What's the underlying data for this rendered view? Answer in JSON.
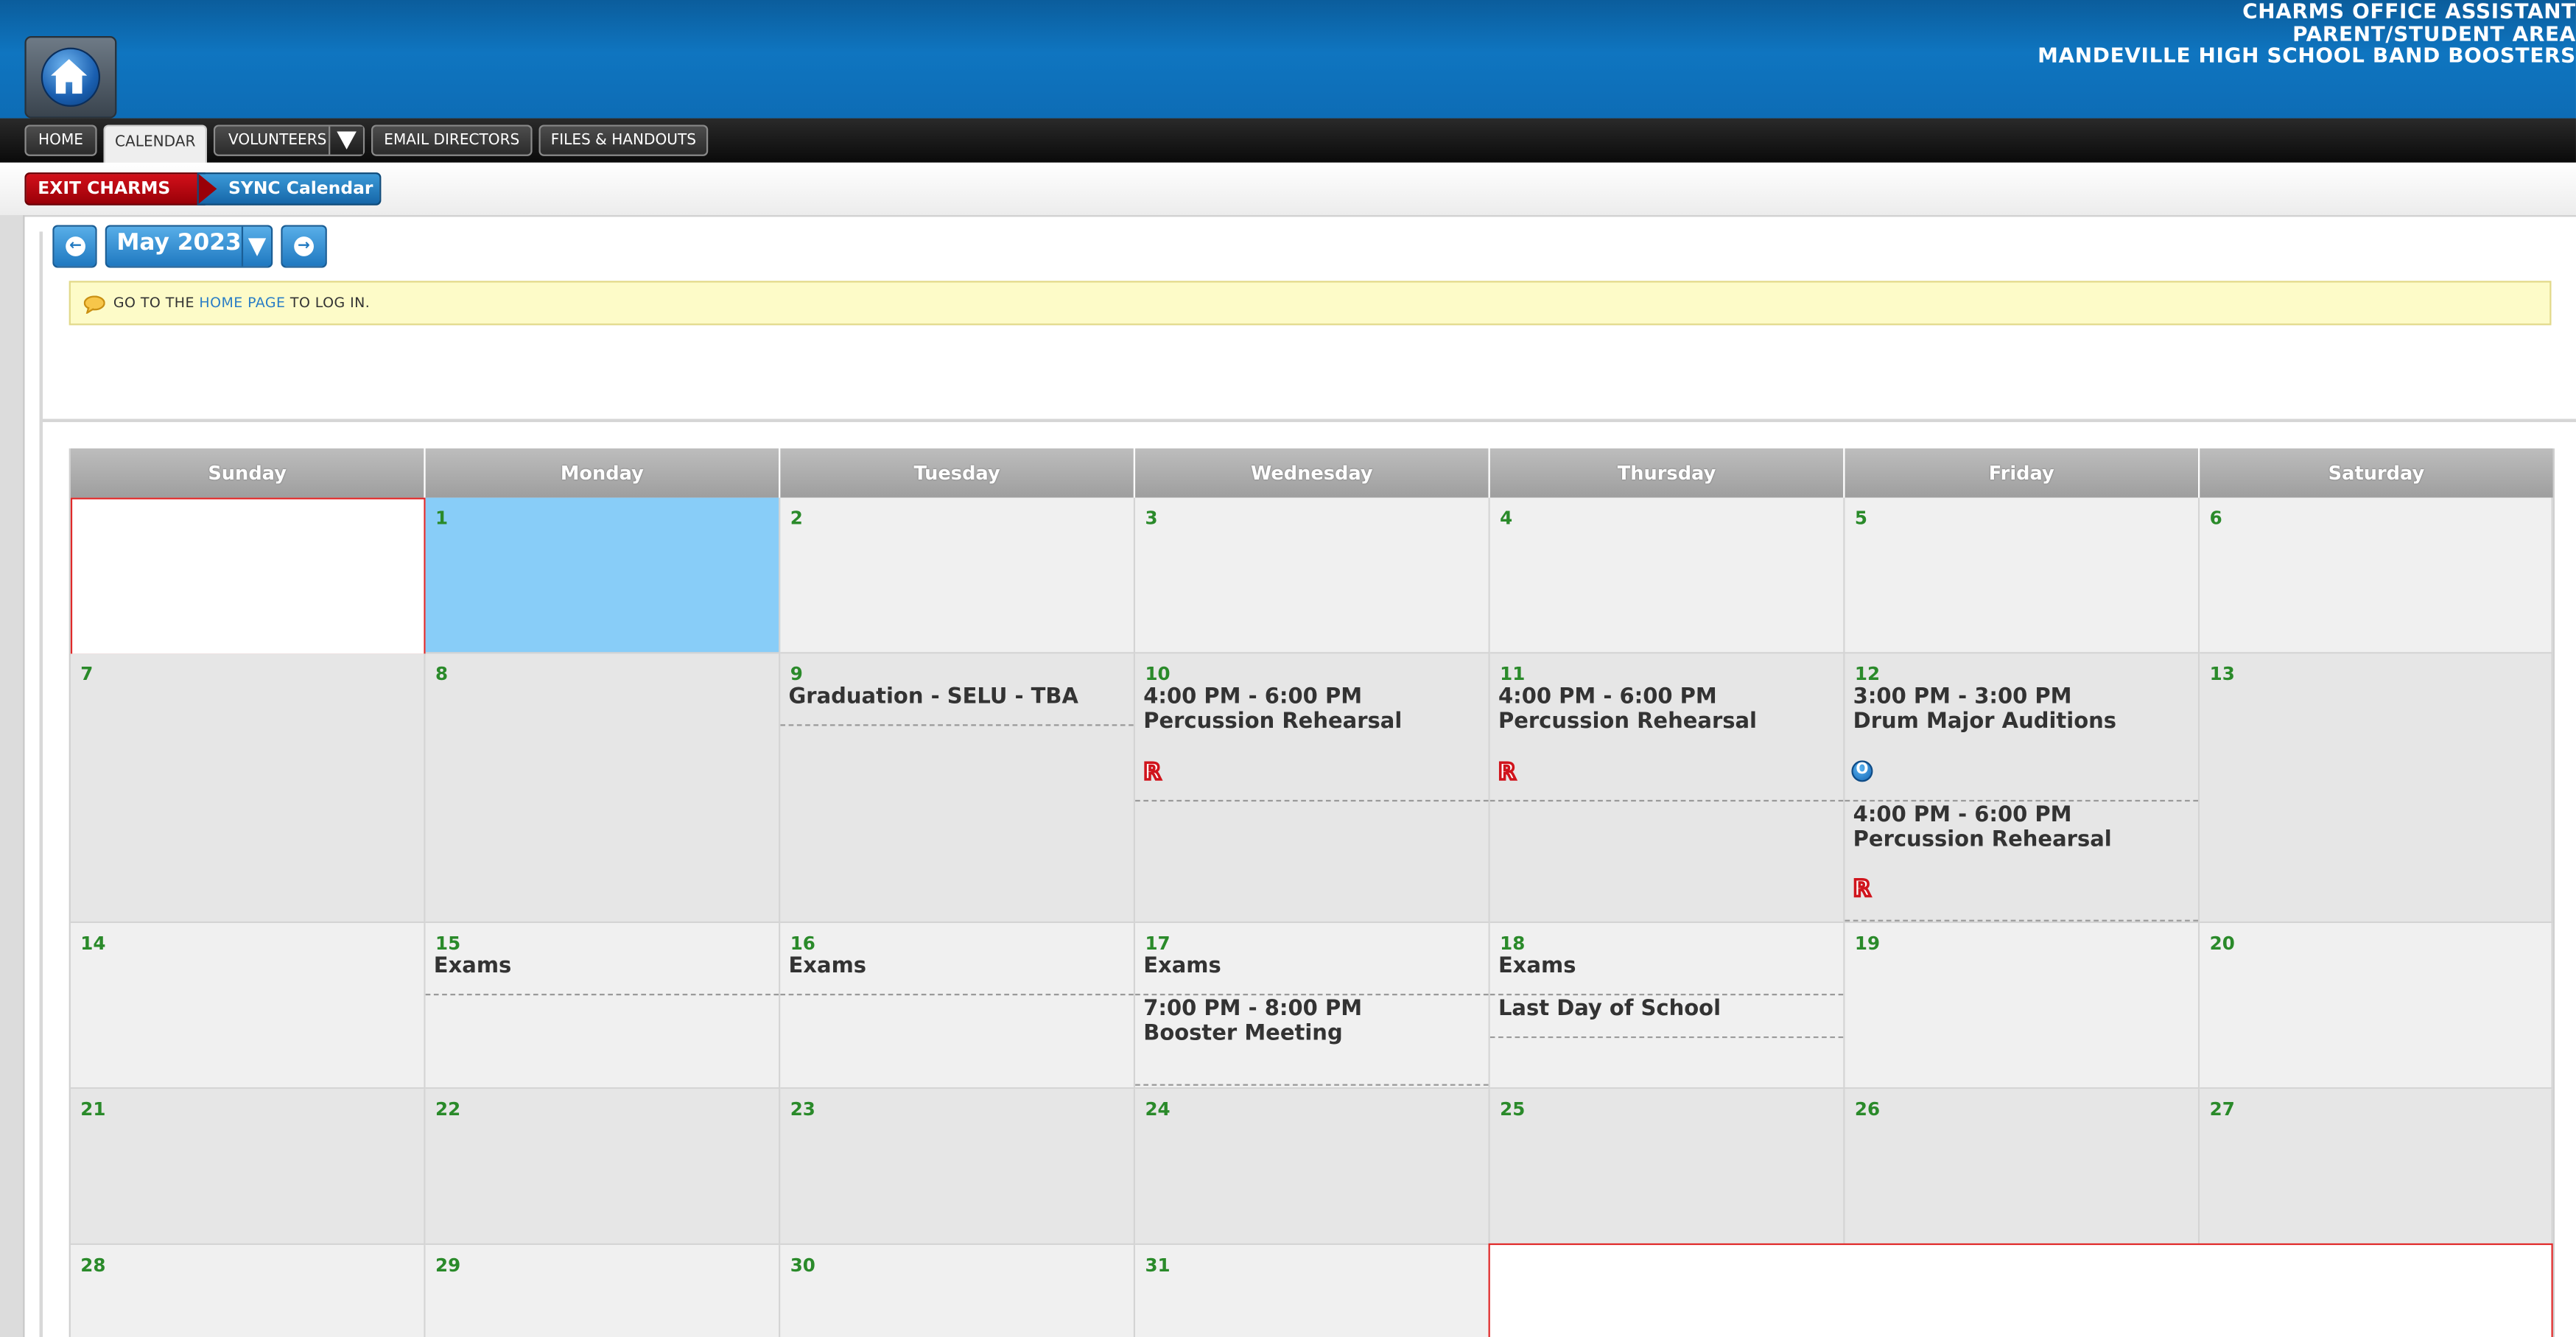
{
  "header": {
    "lines": [
      "CHARMS OFFICE ASSISTANT",
      "PARENT/STUDENT AREA",
      "MANDEVILLE HIGH SCHOOL BAND BOOSTERS"
    ]
  },
  "nav": {
    "home": "HOME",
    "calendar": "CALENDAR",
    "volunteers": "VOLUNTEERS",
    "email_directors": "EMAIL DIRECTORS",
    "files": "FILES & HANDOUTS"
  },
  "actions": {
    "exit": "EXIT CHARMS",
    "sync": "SYNC Calendar"
  },
  "month": {
    "label": "May 2023",
    "prev_glyph": "←",
    "next_glyph": "→"
  },
  "notice": {
    "prefix": "GO TO THE ",
    "link": "HOME PAGE",
    "suffix": " TO LOG IN."
  },
  "weekdays": [
    "Sunday",
    "Monday",
    "Tuesday",
    "Wednesday",
    "Thursday",
    "Friday",
    "Saturday"
  ],
  "days": {
    "d1": "1",
    "d2": "2",
    "d3": "3",
    "d4": "4",
    "d5": "5",
    "d6": "6",
    "d7": "7",
    "d8": "8",
    "d9": "9",
    "d10": "10",
    "d11": "11",
    "d12": "12",
    "d13": "13",
    "d14": "14",
    "d15": "15",
    "d16": "16",
    "d17": "17",
    "d18": "18",
    "d19": "19",
    "d20": "20",
    "d21": "21",
    "d22": "22",
    "d23": "23",
    "d24": "24",
    "d25": "25",
    "d26": "26",
    "d27": "27",
    "d28": "28",
    "d29": "29",
    "d30": "30",
    "d31": "31"
  },
  "events": {
    "e9": "Graduation - SELU - TBA",
    "e10_time": "4:00 PM - 6:00 PM",
    "e10_title": "Percussion Rehearsal",
    "e11_time": "4:00 PM - 6:00 PM",
    "e11_title": "Percussion Rehearsal",
    "e12a_time": "3:00 PM - 3:00 PM",
    "e12a_title": "Drum Major Auditions",
    "e12b_time": "4:00 PM - 6:00 PM",
    "e12b_title": "Percussion Rehearsal",
    "e15": "Exams",
    "e16": "Exams",
    "e17a": "Exams",
    "e17b_time": "7:00 PM - 8:00 PM",
    "e17b_title": "Booster Meeting",
    "e18a": "Exams",
    "e18b": "Last Day of School"
  },
  "badges": {
    "required": "R",
    "optional": "O"
  },
  "colors": {
    "header_blue": "#0f75c0",
    "exit_red": "#c20d16",
    "sync_blue": "#2a86c8",
    "today": "#88cdf8",
    "day_number": "#2a8a2a",
    "notice_bg": "#fdfbc8"
  }
}
